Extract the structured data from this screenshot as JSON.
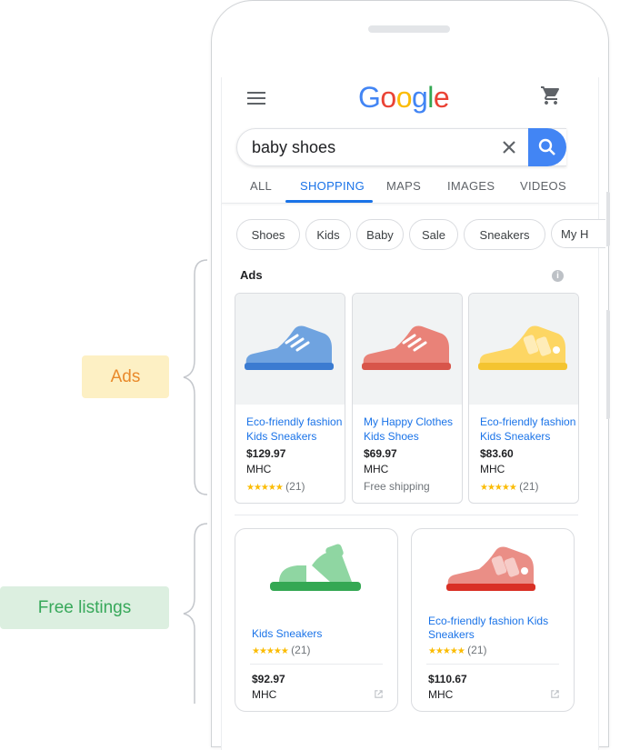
{
  "callouts": {
    "ads": "Ads",
    "free": "Free listings"
  },
  "header": {
    "logo": [
      {
        "ch": "G",
        "color": "#4285f4"
      },
      {
        "ch": "o",
        "color": "#ea4335"
      },
      {
        "ch": "o",
        "color": "#fbbc05"
      },
      {
        "ch": "g",
        "color": "#4285f4"
      },
      {
        "ch": "l",
        "color": "#34a853"
      },
      {
        "ch": "e",
        "color": "#ea4335"
      }
    ]
  },
  "search": {
    "query": "baby shoes"
  },
  "tabs": [
    "ALL",
    "SHOPPING",
    "MAPS",
    "IMAGES",
    "VIDEOS"
  ],
  "active_tab": "SHOPPING",
  "chips": [
    "Shoes",
    "Kids",
    "Baby",
    "Sale",
    "Sneakers",
    "My H"
  ],
  "ads": {
    "label": "Ads",
    "items": [
      {
        "title": "Eco-friendly fashion Kids Sneakers",
        "price": "$129.97",
        "merchant": "MHC",
        "stars": "★★★★★",
        "reviews": "(21)",
        "extra": "",
        "shoe_color": "#6fa3e0",
        "sole_color": "#3b7bd1"
      },
      {
        "title": "My Happy Clothes Kids Shoes",
        "price": "$69.97",
        "merchant": "MHC",
        "stars": "",
        "reviews": "",
        "extra": "Free shipping",
        "shoe_color": "#e98278",
        "sole_color": "#d8554a"
      },
      {
        "title": "Eco-friendly fashion Kids Sneakers",
        "price": "$83.60",
        "merchant": "MHC",
        "stars": "★★★★★",
        "reviews": "(21)",
        "extra": "",
        "shoe_color": "#fdd663",
        "sole_color": "#f4c430"
      }
    ]
  },
  "free_listings": [
    {
      "title": "Kids Sneakers",
      "stars": "★★★★★",
      "reviews": "(21)",
      "price": "$92.97",
      "merchant": "MHC",
      "shoe_color": "#8fd6a2",
      "sole_color": "#34a853"
    },
    {
      "title": "Eco-friendly fashion Kids Sneakers",
      "stars": "★★★★★",
      "reviews": "(21)",
      "price": "$110.67",
      "merchant": "MHC",
      "shoe_color": "#ea8e86",
      "sole_color": "#d93025"
    }
  ]
}
